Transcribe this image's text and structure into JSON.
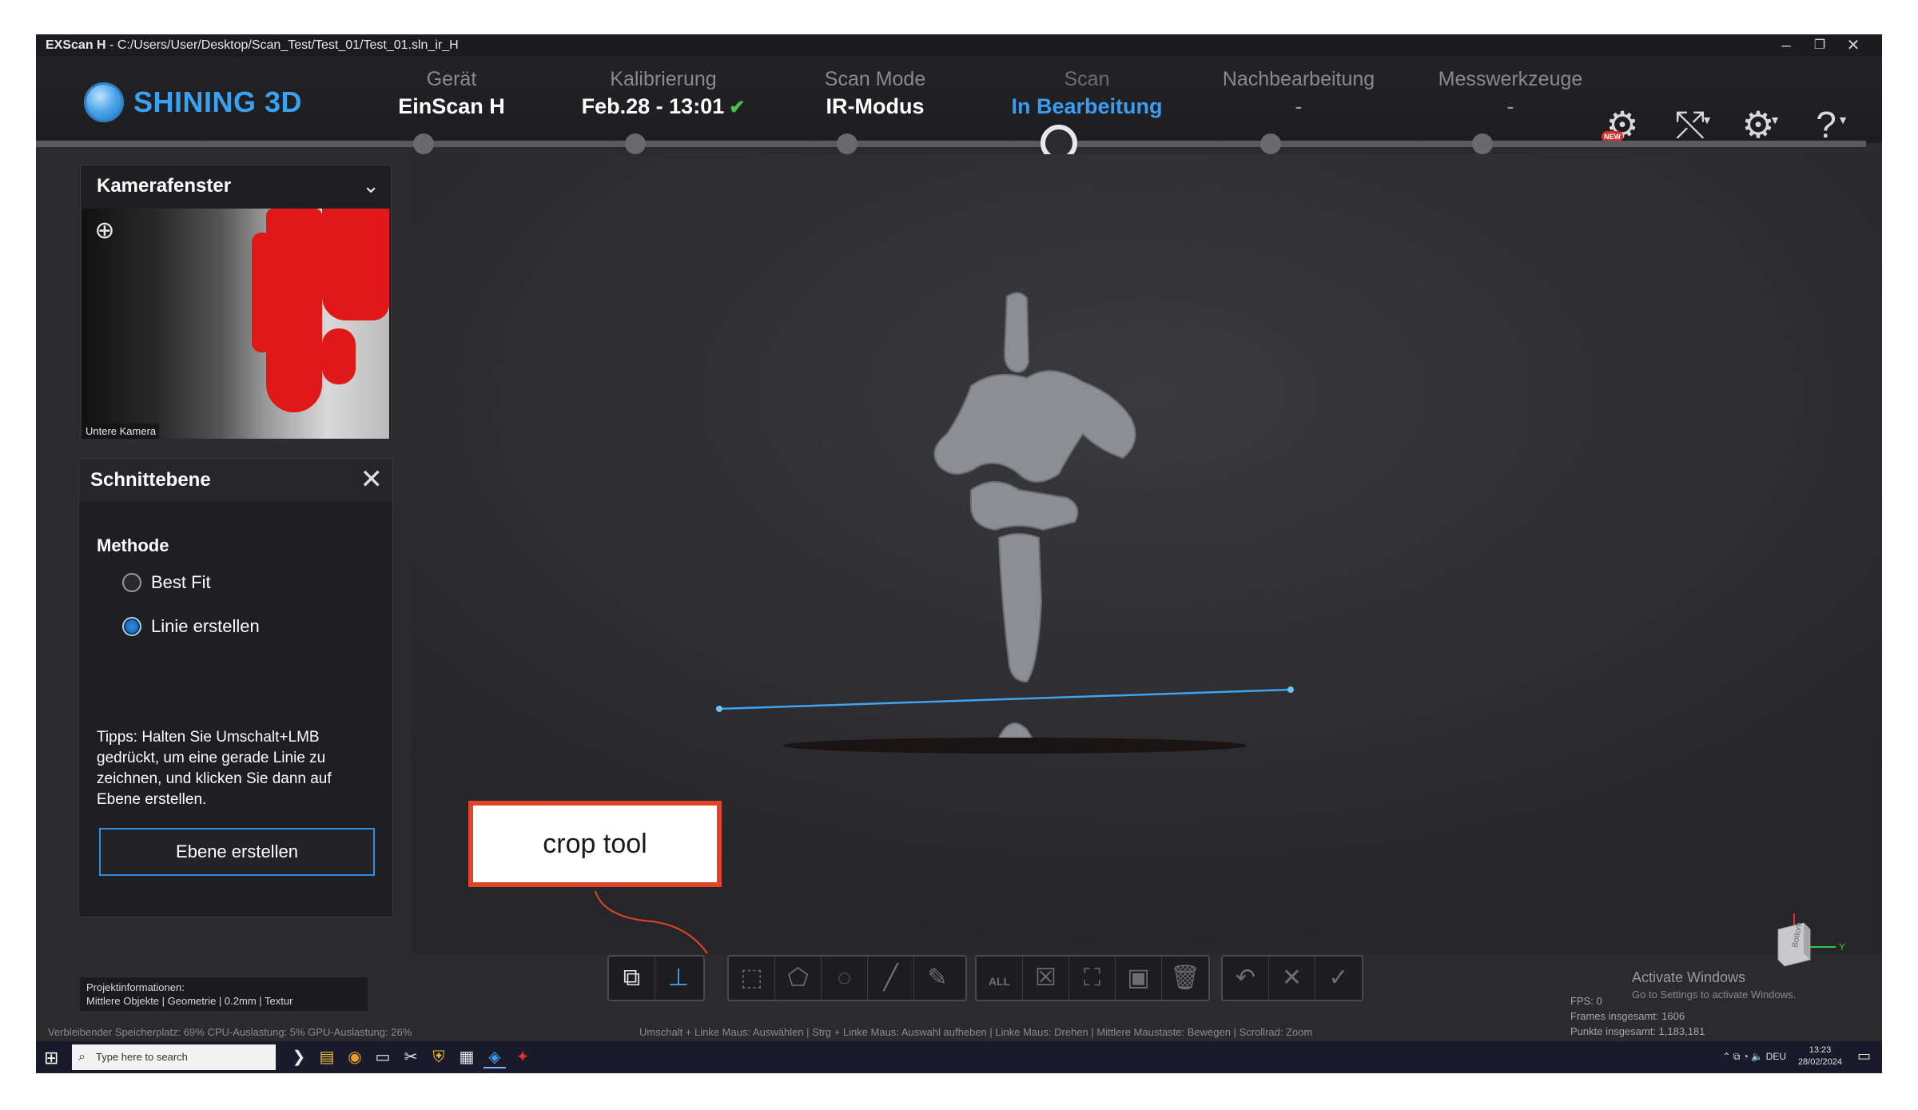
{
  "titlebar": {
    "app": "EXScan H",
    "path": " - C:/Users/User/Desktop/Scan_Test/Test_01/Test_01.sln_ir_H"
  },
  "logo": {
    "text": "SHINING 3D"
  },
  "steps": [
    {
      "label": "Gerät",
      "value": "EinScan H"
    },
    {
      "label": "Kalibrierung",
      "value": "Feb.28 - 13:01",
      "check": "✔"
    },
    {
      "label": "Scan Mode",
      "value": "IR-Modus"
    },
    {
      "label": "Scan",
      "value": "In Bearbeitung"
    },
    {
      "label": "Nachbearbeitung",
      "value": "-"
    },
    {
      "label": "Messwerkzeuge",
      "value": "-"
    }
  ],
  "header_icons": {
    "new_badge": "NEW"
  },
  "camera_panel": {
    "title": "Kamerafenster",
    "caption": "Untere Kamera"
  },
  "section_panel": {
    "title": "Schnittebene",
    "method_label": "Methode",
    "options": [
      "Best Fit",
      "Linie erstellen"
    ],
    "selected": "Linie erstellen",
    "tips": "Tipps: Halten Sie Umschalt+LMB gedrückt, um eine gerade Linie zu zeichnen, und klicken Sie dann auf Ebene erstellen.",
    "button": "Ebene erstellen"
  },
  "annotation": {
    "text": "crop tool"
  },
  "toolbar": {
    "all_label": "ALL"
  },
  "project_info": {
    "title": "Projektinformationen:",
    "details": "Mittlere Objekte | Geometrie | 0.2mm | Textur"
  },
  "status": {
    "resources": "Verbleibender Speicherplatz: 69%  CPU-Auslastung: 5%  GPU-Auslastung: 26%",
    "hints": "Umschalt + Linke Maus: Auswählen | Strg + Linke Maus: Auswahl aufheben | Linke Maus: Drehen | Mittlere Maustaste: Bewegen | Scrollrad: Zoom",
    "fps": "FPS: 0",
    "frames": "Frames insgesamt: 1606",
    "points": "Punkte insgesamt: 1,183,181"
  },
  "watermark": {
    "title": "Activate Windows",
    "subtitle": "Go to Settings to activate Windows."
  },
  "navcube": {
    "face": "Bottom",
    "axis_y": "Y"
  },
  "taskbar": {
    "search_placeholder": "Type here to search",
    "lang": "DEU",
    "time": "13:23",
    "date": "28/02/2024"
  },
  "colors": {
    "accent": "#3a9cf2",
    "annotation_border": "#e2442a",
    "check": "#49c24a"
  }
}
